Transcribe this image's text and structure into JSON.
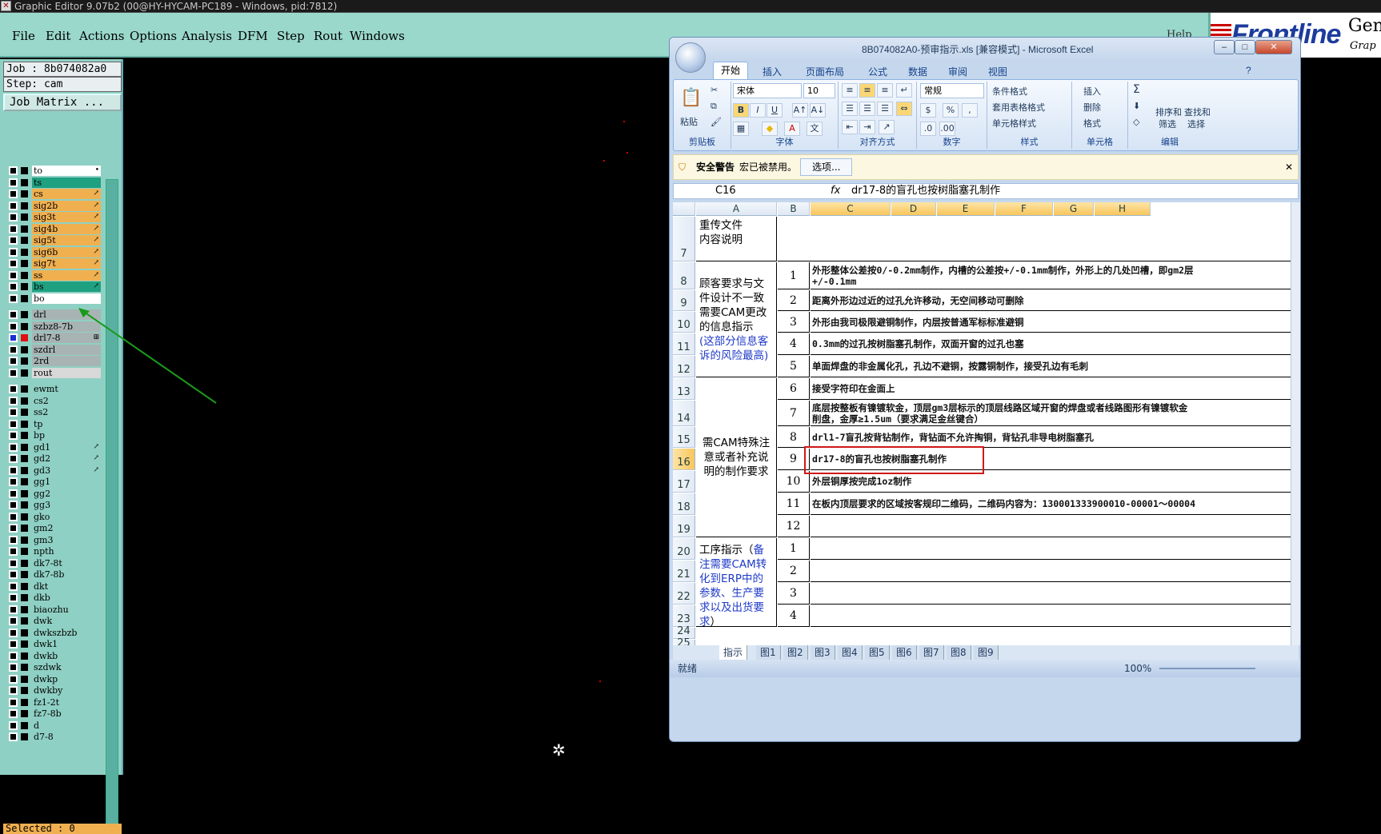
{
  "app_window": {
    "title": "Graphic Editor 9.07b2 (00@HY-HYCAM-PC189 - Windows, pid:7812)",
    "menu": [
      "File",
      "Edit",
      "Actions",
      "Options",
      "Analysis",
      "DFM",
      "Step",
      "Rout",
      "Windows"
    ],
    "help_label": "Help",
    "brand": "Frontline",
    "brand_right_top": "Gene",
    "brand_right_bottom": "Grap"
  },
  "left_panel": {
    "job": "Job : 8b074082a0",
    "step": "Step: cam",
    "job_matrix_button": "Job Matrix ...",
    "selected": "Selected : 0",
    "layers": [
      {
        "name": "to",
        "color": "#ffffff",
        "mark": "•"
      },
      {
        "name": "ts",
        "color": "#1fa080",
        "mark": ""
      },
      {
        "name": "cs",
        "color": "#f0b050",
        "mark": "↗"
      },
      {
        "name": "sig2b",
        "color": "#f0b050",
        "mark": "↗"
      },
      {
        "name": "sig3t",
        "color": "#f0b050",
        "mark": "↗"
      },
      {
        "name": "sig4b",
        "color": "#f0b050",
        "mark": "↗"
      },
      {
        "name": "sig5t",
        "color": "#f0b050",
        "mark": "↗"
      },
      {
        "name": "sig6b",
        "color": "#f0b050",
        "mark": "↗"
      },
      {
        "name": "sig7t",
        "color": "#f0b050",
        "mark": "↗"
      },
      {
        "name": "ss",
        "color": "#f0b050",
        "mark": "↗"
      },
      {
        "name": "bs",
        "color": "#1fa080",
        "mark": "↗"
      },
      {
        "name": "bo",
        "color": "#ffffff",
        "mark": ""
      },
      {
        "name": "drl",
        "color": "#a8b4b4",
        "mark": ""
      },
      {
        "name": "szbz8-7b",
        "color": "#a8b4b4",
        "mark": ""
      },
      {
        "name": "drl7-8",
        "color": "#a8b4b4",
        "mark": "⊞"
      },
      {
        "name": "szdrl",
        "color": "#a8b4b4",
        "mark": ""
      },
      {
        "name": "2rd",
        "color": "#a8b4b4",
        "mark": ""
      },
      {
        "name": "rout",
        "color": "#d8d8d8",
        "mark": ""
      },
      {
        "name": "ewmt",
        "color": "#8fd0c4",
        "mark": ""
      },
      {
        "name": "cs2",
        "color": "#8fd0c4",
        "mark": ""
      },
      {
        "name": "ss2",
        "color": "#8fd0c4",
        "mark": ""
      },
      {
        "name": "tp",
        "color": "#8fd0c4",
        "mark": ""
      },
      {
        "name": "bp",
        "color": "#8fd0c4",
        "mark": ""
      },
      {
        "name": "gd1",
        "color": "#8fd0c4",
        "mark": "↗"
      },
      {
        "name": "gd2",
        "color": "#8fd0c4",
        "mark": "↗"
      },
      {
        "name": "gd3",
        "color": "#8fd0c4",
        "mark": "↗"
      },
      {
        "name": "gg1",
        "color": "#8fd0c4",
        "mark": ""
      },
      {
        "name": "gg2",
        "color": "#8fd0c4",
        "mark": ""
      },
      {
        "name": "gg3",
        "color": "#8fd0c4",
        "mark": ""
      },
      {
        "name": "gko",
        "color": "#8fd0c4",
        "mark": ""
      },
      {
        "name": "gm2",
        "color": "#8fd0c4",
        "mark": ""
      },
      {
        "name": "gm3",
        "color": "#8fd0c4",
        "mark": ""
      },
      {
        "name": "npth",
        "color": "#8fd0c4",
        "mark": ""
      },
      {
        "name": "dk7-8t",
        "color": "#8fd0c4",
        "mark": ""
      },
      {
        "name": "dk7-8b",
        "color": "#8fd0c4",
        "mark": ""
      },
      {
        "name": "dkt",
        "color": "#8fd0c4",
        "mark": ""
      },
      {
        "name": "dkb",
        "color": "#8fd0c4",
        "mark": ""
      },
      {
        "name": "biaozhu",
        "color": "#8fd0c4",
        "mark": ""
      },
      {
        "name": "dwk",
        "color": "#8fd0c4",
        "mark": ""
      },
      {
        "name": "dwkszbzb",
        "color": "#8fd0c4",
        "mark": ""
      },
      {
        "name": "dwk1",
        "color": "#8fd0c4",
        "mark": ""
      },
      {
        "name": "dwkb",
        "color": "#8fd0c4",
        "mark": ""
      },
      {
        "name": "szdwk",
        "color": "#8fd0c4",
        "mark": ""
      },
      {
        "name": "dwkp",
        "color": "#8fd0c4",
        "mark": ""
      },
      {
        "name": "dwkby",
        "color": "#8fd0c4",
        "mark": ""
      },
      {
        "name": "fz1-2t",
        "color": "#8fd0c4",
        "mark": ""
      },
      {
        "name": "fz7-8b",
        "color": "#8fd0c4",
        "mark": ""
      },
      {
        "name": "d",
        "color": "#8fd0c4",
        "mark": ""
      },
      {
        "name": "d7-8",
        "color": "#8fd0c4",
        "mark": ""
      }
    ]
  },
  "excel": {
    "title": "8B074082A0-预审指示.xls [兼容模式] - Microsoft Excel",
    "tabs": [
      "开始",
      "插入",
      "页面布局",
      "公式",
      "数据",
      "审阅",
      "视图"
    ],
    "ribbon": {
      "clipboard": {
        "paste": "粘贴",
        "label": "剪贴板"
      },
      "font": {
        "name": "宋体",
        "size": "10",
        "label": "字体",
        "bold": "B",
        "italic": "I",
        "underline": "U"
      },
      "alignment": {
        "label": "对齐方式"
      },
      "number": {
        "format": "常规",
        "percent": "%",
        "comma": ",",
        "label": "数字"
      },
      "styles": {
        "conditional": "条件格式",
        "table": "套用表格格式",
        "cell": "单元格样式",
        "label": "样式"
      },
      "cells": {
        "insert": "插入",
        "delete": "删除",
        "format": "格式",
        "label": "单元格"
      },
      "editing": {
        "sort": "排序和",
        "sort2": "筛选",
        "find": "查找和",
        "find2": "选择",
        "label": "编辑",
        "sigma": "Σ"
      }
    },
    "security": {
      "title": "安全警告",
      "message": "宏已被禁用。",
      "button": "选项..."
    },
    "name_box": "C16",
    "fx": "fx",
    "formula": "dr17-8的盲孔也按树脂塞孔制作",
    "columns": [
      "A",
      "B",
      "C",
      "D",
      "E",
      "F",
      "G",
      "H"
    ],
    "rows": {
      "r7": {
        "num": "7",
        "a": "重传文件\n内容说明"
      },
      "group1": {
        "a1": "顾客要求与文件设计不一致需要CAM更改的信息指示",
        "a2": "(这部分信息客诉的风险最高)"
      },
      "group2": {
        "a": "需CAM特殊注意或者补充说明的制作要求"
      },
      "group3": {
        "a1": "工序指示（",
        "a2": "备注需要CAM转化到ERP中的参数、生产要求以及出货要求",
        "a3": "）"
      },
      "items": [
        {
          "num": "8",
          "b": "1",
          "c": "外形整体公差按0/-0.2mm制作，内槽的公差按+/-0.1mm制作，外形上的几处凹槽，即gm2层",
          "c2": "+/-0.1mm"
        },
        {
          "num": "9",
          "b": "2",
          "c": "距离外形边过近的过孔允许移动，无空间移动可删除",
          "c2": ""
        },
        {
          "num": "10",
          "b": "3",
          "c": "外形由我司极限避铜制作，内层按普通军标标准避铜",
          "c2": ""
        },
        {
          "num": "11",
          "b": "4",
          "c": "0.3mm的过孔按树脂塞孔制作，双面开窗的过孔也塞",
          "c2": ""
        },
        {
          "num": "12",
          "b": "5",
          "c": "单面焊盘的非金属化孔，孔边不避铜，按露铜制作，接受孔边有毛刺",
          "c2": ""
        },
        {
          "num": "13",
          "b": "6",
          "c": "接受字符印在金面上",
          "c2": ""
        },
        {
          "num": "14",
          "b": "7",
          "c": "底层按整板有镍镀软金，顶层gm3层标示的顶层线路区域开窗的焊盘或者线路图形有镍镀软金",
          "c2": "削盘，金厚≥1.5um（要求满足金丝键合）"
        },
        {
          "num": "15",
          "b": "8",
          "c": "drl1-7盲孔按背钻制作，背钻面不允许掏铜，背钻孔非导电树脂塞孔",
          "c2": ""
        },
        {
          "num": "16",
          "b": "9",
          "c": "dr17-8的盲孔也按树脂塞孔制作",
          "c2": ""
        },
        {
          "num": "17",
          "b": "10",
          "c": "外层铜厚按完成1oz制作",
          "c2": ""
        },
        {
          "num": "18",
          "b": "11",
          "c": "在板内顶层要求的区域按客规印二维码，二维码内容为：130001333900010-00001～00004",
          "c2": ""
        },
        {
          "num": "19",
          "b": "12",
          "c": "",
          "c2": ""
        },
        {
          "num": "20",
          "b": "1",
          "c": "",
          "c2": ""
        },
        {
          "num": "21",
          "b": "2",
          "c": "",
          "c2": ""
        },
        {
          "num": "22",
          "b": "3",
          "c": "",
          "c2": ""
        },
        {
          "num": "23",
          "b": "4",
          "c": "",
          "c2": ""
        },
        {
          "num": "24",
          "b": "",
          "c": "",
          "c2": ""
        },
        {
          "num": "25",
          "b": "",
          "c": "",
          "c2": ""
        }
      ]
    },
    "sheet_tabs": [
      "指示",
      "图1",
      "图2",
      "图3",
      "图4",
      "图5",
      "图6",
      "图7",
      "图8",
      "图9"
    ],
    "status": {
      "ready": "就绪",
      "zoom": "100%"
    }
  }
}
